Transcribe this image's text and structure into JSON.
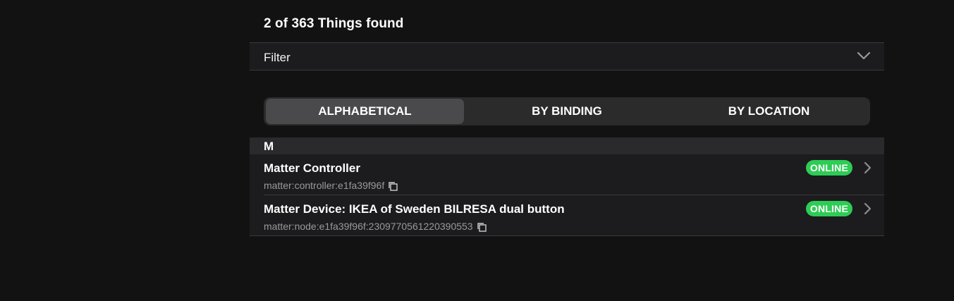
{
  "header": {
    "result_count": "2 of 363 Things found"
  },
  "filter": {
    "label": "Filter",
    "chevron_icon": "chevron-down-icon"
  },
  "view_tabs": [
    {
      "label": "ALPHABETICAL",
      "active": true
    },
    {
      "label": "BY BINDING",
      "active": false
    },
    {
      "label": "BY LOCATION",
      "active": false
    }
  ],
  "groups": [
    {
      "letter": "M",
      "things": [
        {
          "name": "Matter Controller",
          "uid": "matter:controller:e1fa39f96f",
          "status": "ONLINE"
        },
        {
          "name": "Matter Device: IKEA of Sweden BILRESA dual button",
          "uid": "matter:node:e1fa39f96f:2309770561220390553",
          "status": "ONLINE"
        }
      ]
    }
  ],
  "colors": {
    "background": "#121212",
    "surface": "#1c1c1e",
    "online": "#2ecc55",
    "muted_text": "#9a9a9a"
  }
}
